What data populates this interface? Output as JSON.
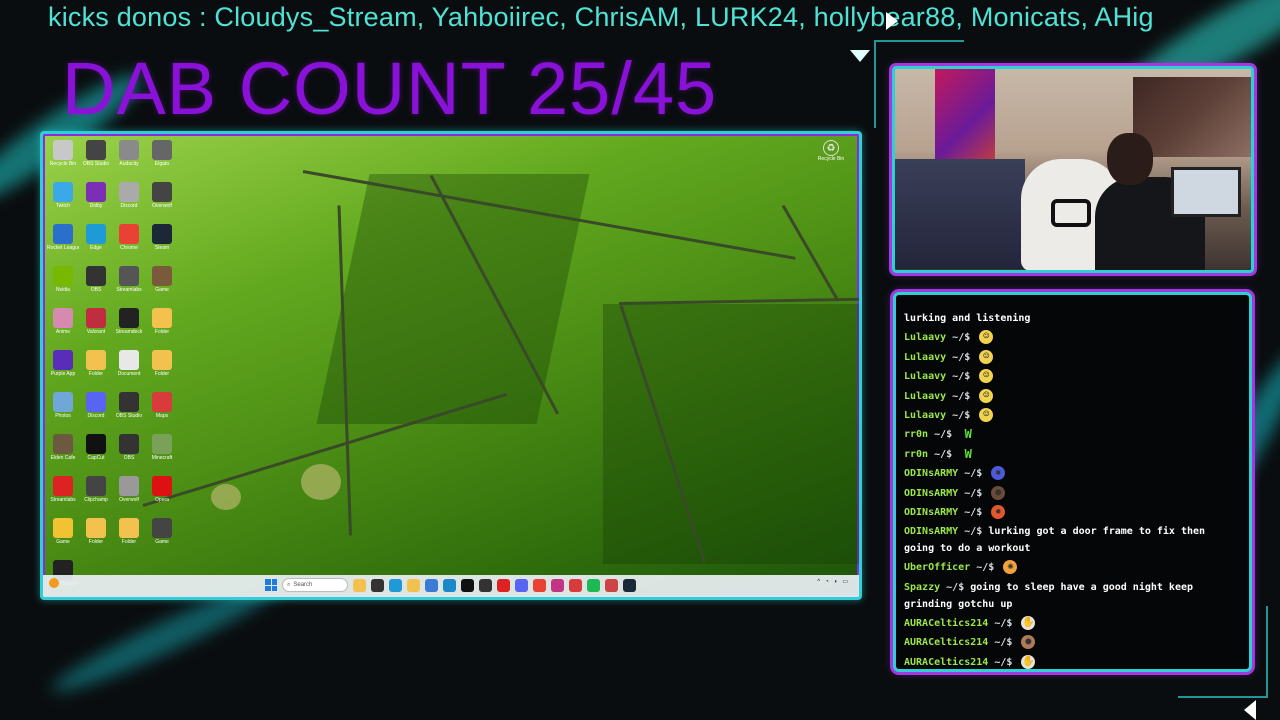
{
  "ticker": {
    "text": "kicks donos : Cloudys_Stream, Yahboiirec, ChrisAM, LURK24, hollybear88, Monicats, AHig"
  },
  "counter": {
    "text": "DAB COUNT 25/45"
  },
  "colors": {
    "accent_cyan": "#2fd0d4",
    "accent_purple": "#a239e0",
    "counter_purple": "#8a12d8",
    "ticker_teal": "#4fe3d6",
    "chat_user_green": "#9be84a"
  },
  "desktop": {
    "icons": [
      {
        "label": "Recycle Bin",
        "icon": "folder-icon",
        "color": "#c8c8c8"
      },
      {
        "label": "OBS Studio",
        "icon": "app-icon",
        "color": "#444"
      },
      {
        "label": "Audacity",
        "icon": "app-icon",
        "color": "#8a8a8a"
      },
      {
        "label": "Elgato",
        "icon": "app-icon",
        "color": "#666"
      },
      {
        "label": "Twitch",
        "icon": "app-icon",
        "color": "#3ba9e8"
      },
      {
        "label": "Dolby",
        "icon": "app-icon",
        "color": "#7b2fb5"
      },
      {
        "label": "Discord",
        "icon": "app-icon",
        "color": "#aaa"
      },
      {
        "label": "Overwolf",
        "icon": "app-icon",
        "color": "#444"
      },
      {
        "label": "Rocket League",
        "icon": "app-icon",
        "color": "#2a6fc9"
      },
      {
        "label": "Edge",
        "icon": "edge-icon",
        "color": "#1e9ad6"
      },
      {
        "label": "Chrome",
        "icon": "chrome-icon",
        "color": "#e94235"
      },
      {
        "label": "Steam",
        "icon": "steam-icon",
        "color": "#1b2838"
      },
      {
        "label": "Nvidia",
        "icon": "app-icon",
        "color": "#76b900"
      },
      {
        "label": "OBS",
        "icon": "obs-icon",
        "color": "#333"
      },
      {
        "label": "Streamlabs",
        "icon": "app-icon",
        "color": "#555"
      },
      {
        "label": "Game",
        "icon": "app-icon",
        "color": "#7a5a3a"
      },
      {
        "label": "Anime",
        "icon": "app-icon",
        "color": "#d78ab0"
      },
      {
        "label": "Valorant",
        "icon": "app-icon",
        "color": "#c02d3f"
      },
      {
        "label": "Streamdeck",
        "icon": "app-icon",
        "color": "#222"
      },
      {
        "label": "Folder",
        "icon": "folder-icon",
        "color": "#f2c14e"
      },
      {
        "label": "Purple App",
        "icon": "app-icon",
        "color": "#5a2db8"
      },
      {
        "label": "Folder",
        "icon": "folder-icon",
        "color": "#f2c14e"
      },
      {
        "label": "Document",
        "icon": "file-icon",
        "color": "#e8e8e8"
      },
      {
        "label": "Folder",
        "icon": "folder-icon",
        "color": "#f2c14e"
      },
      {
        "label": "Photos",
        "icon": "app-icon",
        "color": "#6ea7d8"
      },
      {
        "label": "Discord",
        "icon": "discord-icon",
        "color": "#5865f2"
      },
      {
        "label": "OBS Studio",
        "icon": "obs-icon",
        "color": "#333"
      },
      {
        "label": "Maps",
        "icon": "app-icon",
        "color": "#d83b3b"
      },
      {
        "label": "Elden Cafe",
        "icon": "app-icon",
        "color": "#6c5a40"
      },
      {
        "label": "CapCut",
        "icon": "app-icon",
        "color": "#111"
      },
      {
        "label": "OBS",
        "icon": "obs-icon",
        "color": "#333"
      },
      {
        "label": "Minecraft",
        "icon": "app-icon",
        "color": "#7aa15a"
      },
      {
        "label": "Streamlabs",
        "icon": "app-icon",
        "color": "#d22"
      },
      {
        "label": "Clipchamp",
        "icon": "app-icon",
        "color": "#444"
      },
      {
        "label": "Overwolf",
        "icon": "app-icon",
        "color": "#999"
      },
      {
        "label": "Opera",
        "icon": "app-icon",
        "color": "#d11"
      },
      {
        "label": "Game",
        "icon": "app-icon",
        "color": "#f1c232"
      },
      {
        "label": "Folder",
        "icon": "folder-icon",
        "color": "#f2c14e"
      },
      {
        "label": "Folder",
        "icon": "folder-icon",
        "color": "#f2c14e"
      },
      {
        "label": "Game",
        "icon": "app-icon",
        "color": "#444"
      },
      {
        "label": "Epic Games",
        "icon": "app-icon",
        "color": "#222"
      }
    ],
    "recycle_label": "Recycle Bin",
    "taskbar": {
      "search_placeholder": "Search"
    }
  },
  "chat": {
    "messages": [
      {
        "user": "",
        "prompt": "",
        "text": "lurking and listening",
        "emote": null
      },
      {
        "user": "Lulaavy",
        "prompt": "~/$",
        "text": "",
        "emote": "smile-emote"
      },
      {
        "user": "Lulaavy",
        "prompt": "~/$",
        "text": "",
        "emote": "smile-emote"
      },
      {
        "user": "Lulaavy",
        "prompt": "~/$",
        "text": "",
        "emote": "smile-emote"
      },
      {
        "user": "Lulaavy",
        "prompt": "~/$",
        "text": "",
        "emote": "smile-emote"
      },
      {
        "user": "Lulaavy",
        "prompt": "~/$",
        "text": "",
        "emote": "smile-emote"
      },
      {
        "user": "rr0n",
        "prompt": "~/$",
        "text": "W",
        "emote": null
      },
      {
        "user": "rr0n",
        "prompt": "~/$",
        "text": "W",
        "emote": null
      },
      {
        "user": "ODINsARMY",
        "prompt": "~/$",
        "text": "",
        "emote": "blue-emote"
      },
      {
        "user": "ODINsARMY",
        "prompt": "~/$",
        "text": "",
        "emote": "face-emote"
      },
      {
        "user": "ODINsARMY",
        "prompt": "~/$",
        "text": "",
        "emote": "fire-emote"
      },
      {
        "user": "ODINsARMY",
        "prompt": "~/$",
        "text": "lurking got a door frame to fix then going to do a workout",
        "emote": null
      },
      {
        "user": "UberOfficer",
        "prompt": "~/$",
        "text": "",
        "emote": "explode-emote"
      },
      {
        "user": "Spazzy",
        "prompt": "~/$",
        "text": "going to sleep have a good night keep grinding gotchu up",
        "emote": null
      },
      {
        "user": "AURACeltics214",
        "prompt": "~/$",
        "text": "",
        "emote": "hand-emote"
      },
      {
        "user": "AURACeltics214",
        "prompt": "~/$",
        "text": "",
        "emote": "bear-emote"
      },
      {
        "user": "AURACeltics214",
        "prompt": "~/$",
        "text": "",
        "emote": "hand-emote"
      }
    ]
  }
}
